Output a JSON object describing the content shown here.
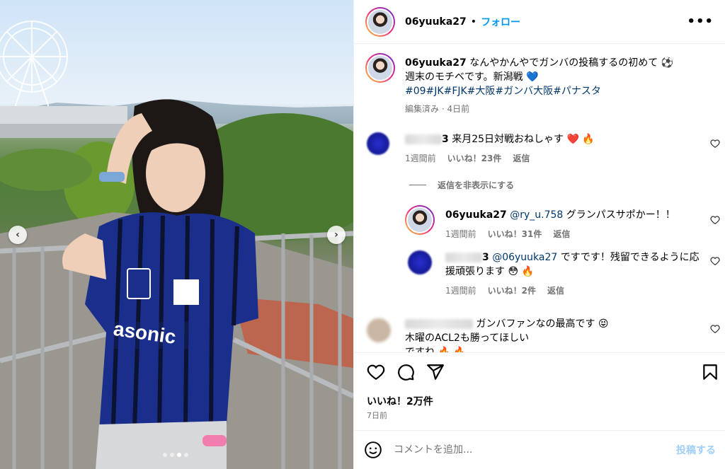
{
  "post": {
    "username": "06yuuka27",
    "separator": "•",
    "follow_label": "フォロー",
    "more_label": "•••"
  },
  "caption": {
    "username": "06yuuka27",
    "line1": "なんやかんやでガンバの投稿するの初めて ⚽",
    "line2": "週末のモチベです。新潟戦 💙",
    "hashtags": "#09#JK#FJK#大阪#ガンバ大阪#パナスタ",
    "meta": "編集済み · 4日前"
  },
  "comments": [
    {
      "username_suffix": "3",
      "text": "来月25日対戦おねしゃす ❤️ 🔥",
      "time": "1週間前",
      "likes": "いいね！23件",
      "reply_label": "返信",
      "hide_replies": "返信を非表示にする",
      "replies": [
        {
          "username": "06yuuka27",
          "mention": "@ry_u.758",
          "text": " グランパスサポかー！！",
          "time": "1週間前",
          "likes": "いいね！31件",
          "reply_label": "返信"
        },
        {
          "username_suffix": "3",
          "mention": "@06yuuka27",
          "text": " ですです！残留できるように応",
          "text2": "援頑張ります 😳 🔥",
          "time": "1週間前",
          "likes": "いいね！2件",
          "reply_label": "返信"
        }
      ]
    },
    {
      "text": "ガンバファンなの最高です 😝",
      "text2": "木曜のACL2も勝ってほしい",
      "text3": "ですね 🔥 🔥"
    }
  ],
  "actions": {
    "likes": "いいね！2万件",
    "date": "7日前"
  },
  "composer": {
    "placeholder": "コメントを追加...",
    "post_label": "投稿する"
  },
  "carousel": {
    "prev_label": "‹",
    "next_label": "›",
    "slide_count": 4,
    "active_slide": 3
  },
  "colors": {
    "accent": "#0095f6",
    "hashtag": "#00376b",
    "muted": "#737373",
    "jersey": "#1a2f8c"
  }
}
